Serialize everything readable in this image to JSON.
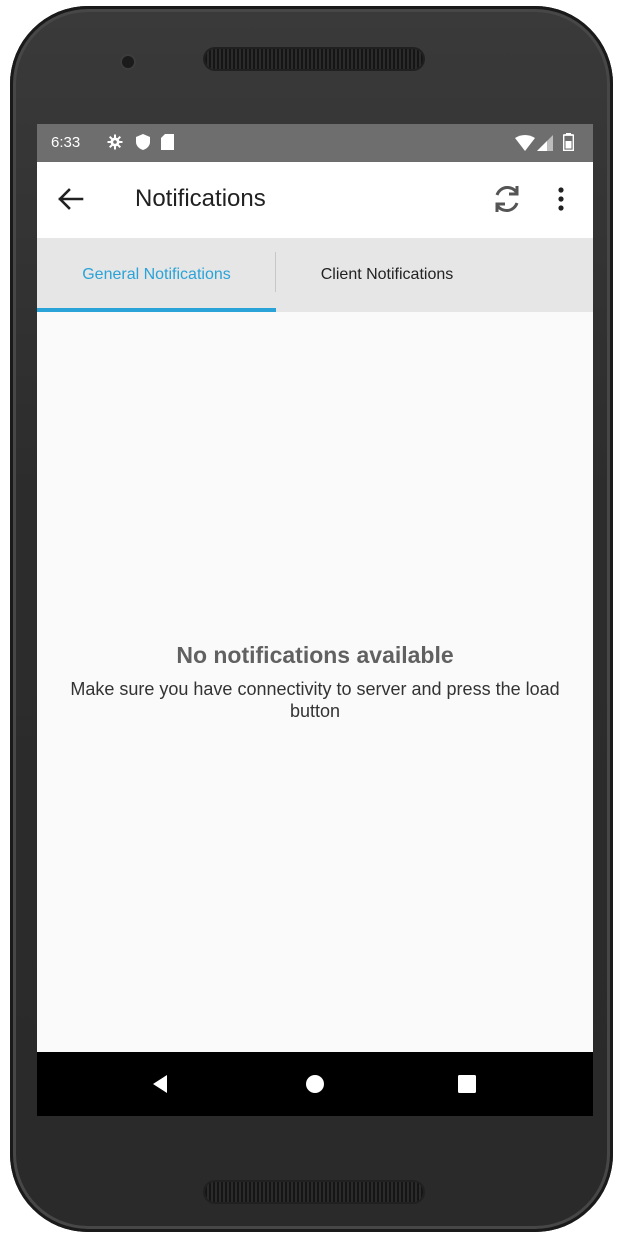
{
  "status_bar": {
    "time": "6:33",
    "left_icons": [
      "settings-icon",
      "shield-icon",
      "sd-card-icon"
    ],
    "right_icons": [
      "wifi-icon",
      "signal-icon",
      "battery-icon"
    ]
  },
  "app_bar": {
    "title": "Notifications",
    "back_icon": "arrow-left-icon",
    "refresh_icon": "refresh-icon",
    "menu_icon": "more-vert-icon"
  },
  "tabs": [
    {
      "label": "General Notifications",
      "selected": true
    },
    {
      "label": "Client Notifications",
      "selected": false
    }
  ],
  "empty_state": {
    "title": "No notifications available",
    "message": "Make sure you have connectivity to server and press the load button"
  },
  "nav_bar": {
    "buttons": [
      "back-triangle-icon",
      "home-circle-icon",
      "recents-square-icon"
    ]
  },
  "colors": {
    "accent": "#29a3d8",
    "status_bar": "#6e6e6e",
    "tab_background": "#e6e6e6",
    "nav_bar": "#000000"
  }
}
